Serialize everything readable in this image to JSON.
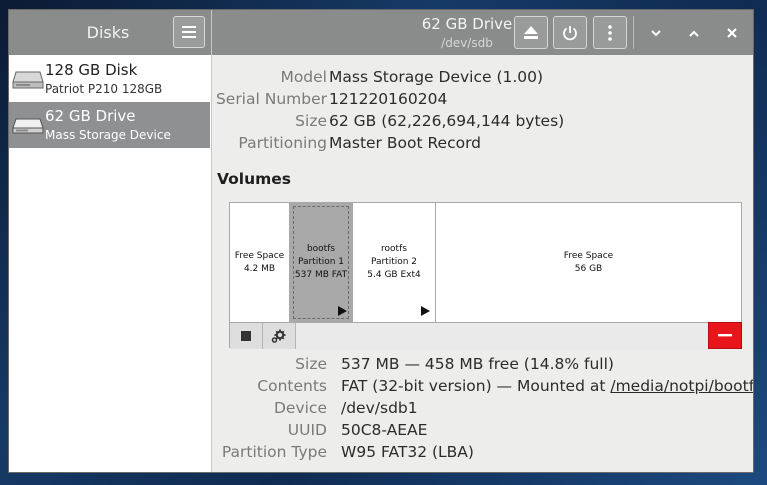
{
  "sidebar": {
    "title": "Disks",
    "disks": [
      {
        "name": "128 GB Disk",
        "subtitle": "Patriot P210 128GB",
        "selected": false
      },
      {
        "name": "62 GB Drive",
        "subtitle": "Mass Storage Device",
        "selected": true
      }
    ]
  },
  "header": {
    "title": "62 GB Drive",
    "subtitle": "/dev/sdb",
    "icons": [
      "eject-icon",
      "power-icon",
      "kebab-menu-icon",
      "minimize-icon",
      "maximize-icon",
      "close-icon"
    ]
  },
  "drive_info": [
    {
      "label": "Model",
      "value": "Mass Storage Device (1.00)"
    },
    {
      "label": "Serial Number",
      "value": "121220160204"
    },
    {
      "label": "Size",
      "value": "62 GB (62,226,694,144 bytes)"
    },
    {
      "label": "Partitioning",
      "value": "Master Boot Record"
    }
  ],
  "volumes": {
    "title": "Volumes",
    "partitions": [
      {
        "line1": "Free Space",
        "line2": "4.2 MB",
        "line3": ""
      },
      {
        "line1": "bootfs",
        "line2": "Partition 1",
        "line3": "537 MB FAT",
        "selected": true
      },
      {
        "line1": "rootfs",
        "line2": "Partition 2",
        "line3": "5.4 GB Ext4"
      },
      {
        "line1": "Free Space",
        "line2": "56 GB",
        "line3": ""
      }
    ]
  },
  "partition_info": [
    {
      "label": "Size",
      "value": "537 MB — 458 MB free (14.8% full)"
    },
    {
      "label": "Contents",
      "value_prefix": "FAT (32-bit version) — Mounted at ",
      "value_link": "/media/notpi/bootfs"
    },
    {
      "label": "Device",
      "value": "/dev/sdb1"
    },
    {
      "label": "UUID",
      "value": "50C8-AEAE"
    },
    {
      "label": "Partition Type",
      "value": "W95 FAT32 (LBA)"
    }
  ],
  "colors": {
    "header_bg": "#8a8c8c",
    "selection_bg": "#8e9091",
    "delete_red": "#e8151b"
  }
}
